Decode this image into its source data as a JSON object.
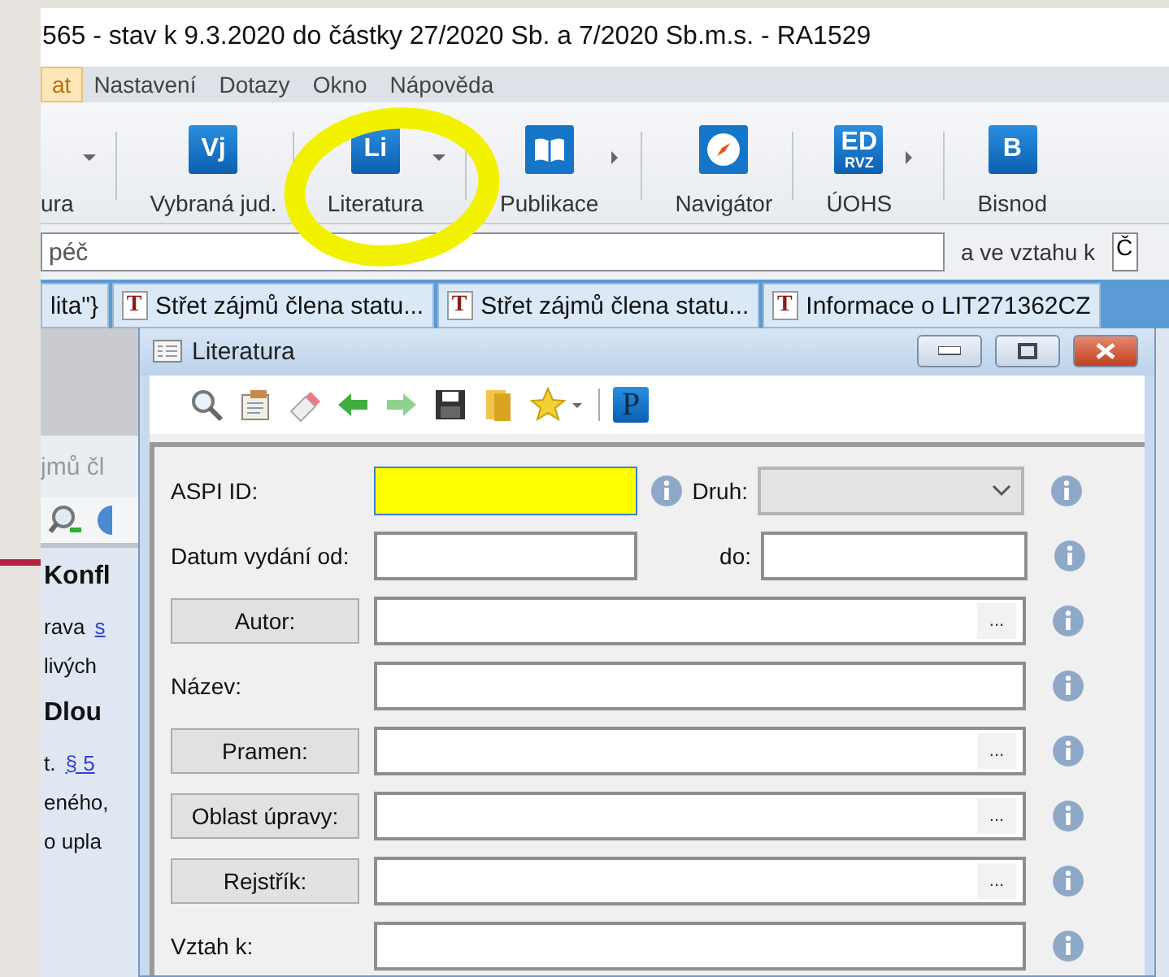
{
  "window": {
    "title": "565 - stav k 9.3.2020 do částky 27/2020 Sb. a 7/2020 Sb.m.s. - RA1529"
  },
  "menu": [
    {
      "label": "at",
      "selected": true
    },
    {
      "label": "Nastavení",
      "selected": false
    },
    {
      "label": "Dotazy",
      "selected": false
    },
    {
      "label": "Okno",
      "selected": false
    },
    {
      "label": "Nápověda",
      "selected": false
    }
  ],
  "toolbar": [
    {
      "label": "ura",
      "kind": "plain",
      "dropdown": true,
      "flyout": false,
      "circled": false
    },
    {
      "label": "Vybraná jud.",
      "kind": "letters",
      "icon_text": "Vj",
      "dropdown": false,
      "flyout": false,
      "circled": false
    },
    {
      "label": "Literatura",
      "kind": "letters",
      "icon_text": "Li",
      "dropdown": true,
      "flyout": false,
      "circled": true
    },
    {
      "label": "Publikace",
      "kind": "book",
      "dropdown": false,
      "flyout": true,
      "circled": false
    },
    {
      "label": "Navigátor",
      "kind": "compass",
      "dropdown": false,
      "flyout": false,
      "circled": false
    },
    {
      "label": "ÚOHS",
      "kind": "stacked",
      "icon_text": "ED",
      "icon_subtext": "RVZ",
      "dropdown": false,
      "flyout": true,
      "circled": false
    },
    {
      "label": "Bisnod",
      "kind": "network",
      "icon_text": "B",
      "dropdown": false,
      "flyout": false,
      "circled": false
    }
  ],
  "search": {
    "value": "péč",
    "relation_label": "a ve vztahu k",
    "extra": "Č"
  },
  "tabs": [
    {
      "label": "lita\"}"
    },
    {
      "label": "Střet zájmů člena statu...",
      "badge": "T"
    },
    {
      "label": "Střet zájmů člena statu...",
      "badge": "T"
    },
    {
      "label": "Informace o LIT271362CZ",
      "badge": "T"
    }
  ],
  "document": {
    "tab_text": "jmů čl",
    "lines": [
      {
        "kind": "heading",
        "text": "Konfl"
      },
      {
        "kind": "text",
        "text": "rava",
        "link": "s"
      },
      {
        "kind": "text",
        "text": "livých"
      },
      {
        "kind": "heading",
        "text": "Dlou"
      },
      {
        "kind": "text",
        "text": "t.",
        "link": "§ 5"
      },
      {
        "kind": "text",
        "text": "eného,"
      },
      {
        "kind": "text",
        "text": "o  upla"
      }
    ]
  },
  "dialog": {
    "title": "Literatura",
    "toolbar": [
      {
        "kind": "search"
      },
      {
        "kind": "notes"
      },
      {
        "kind": "eraser"
      },
      {
        "kind": "back"
      },
      {
        "kind": "forward"
      },
      {
        "kind": "save"
      },
      {
        "kind": "folder"
      },
      {
        "kind": "favorite"
      },
      {
        "kind": "separator"
      },
      {
        "kind": "letter",
        "text": "P"
      }
    ],
    "rows": [
      {
        "kind": "id",
        "label": "ASPI ID:",
        "highlighted": true,
        "second_label": "Druh:",
        "select_disabled": true
      },
      {
        "kind": "range",
        "label": "Datum vydání  od:",
        "to_label": "do:"
      },
      {
        "kind": "button",
        "label": "Autor:",
        "picker": "..."
      },
      {
        "kind": "plain",
        "label": "Název:"
      },
      {
        "kind": "button",
        "label": "Pramen:",
        "picker": "..."
      },
      {
        "kind": "button",
        "label": "Oblast úpravy:",
        "picker": "..."
      },
      {
        "kind": "button",
        "label": "Rejstřík:",
        "picker": "..."
      },
      {
        "kind": "plain",
        "label": "Vztah k:"
      }
    ]
  }
}
